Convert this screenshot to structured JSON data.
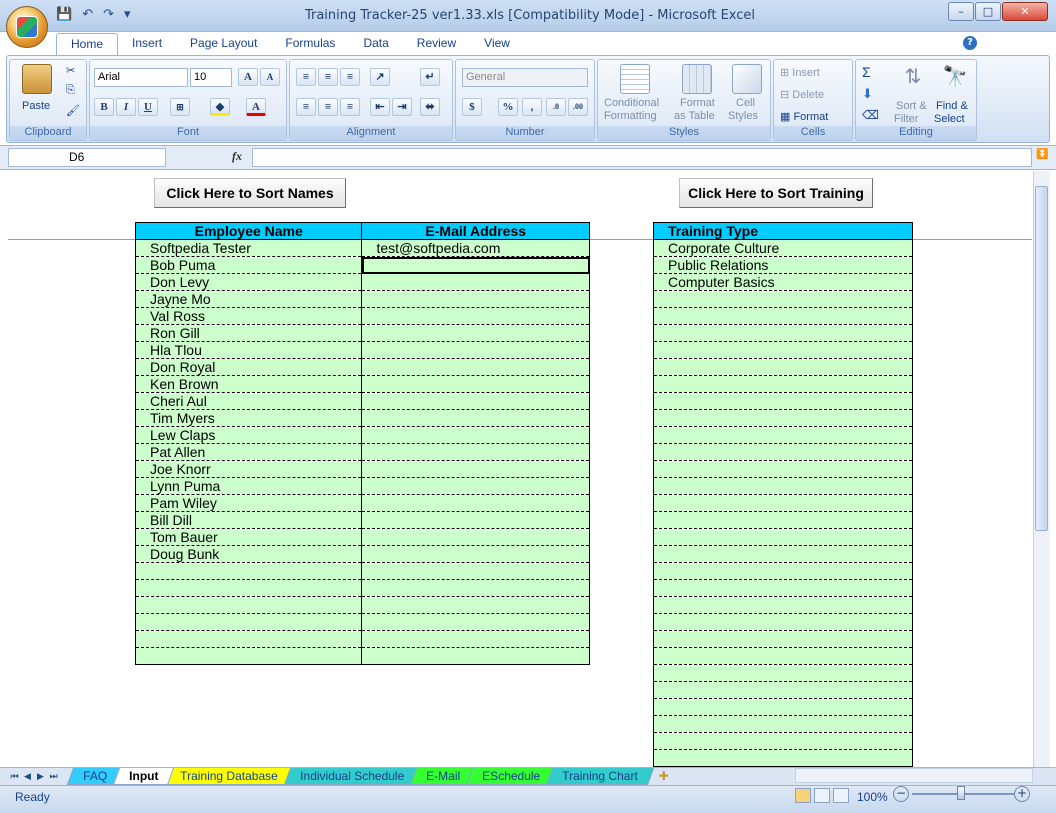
{
  "window": {
    "title": "Training Tracker-25 ver1.33.xls  [Compatibility Mode] - Microsoft Excel",
    "minimize": "–",
    "maximize": "□",
    "close": "✕"
  },
  "ribbon_tabs": [
    "Home",
    "Insert",
    "Page Layout",
    "Formulas",
    "Data",
    "Review",
    "View"
  ],
  "ribbon": {
    "font_name": "Arial",
    "font_size": "10",
    "number_format": "General",
    "paste": "Paste",
    "conditional": "Conditional",
    "formatting": "Formatting",
    "format": "Format",
    "as_table": "as Table",
    "cell": "Cell",
    "styles": "Styles",
    "insert": "Insert",
    "delete": "Delete",
    "format_cells": "Format",
    "sort": "Sort &",
    "filter": "Filter",
    "find": "Find &",
    "select": "Select",
    "groups": {
      "clipboard": "Clipboard",
      "font": "Font",
      "alignment": "Alignment",
      "number": "Number",
      "styles": "Styles",
      "cells": "Cells",
      "editing": "Editing"
    }
  },
  "formula_bar": {
    "name_box": "D6",
    "fx": "fx",
    "value": ""
  },
  "sheet": {
    "sort_names_button": "Click Here to Sort Names",
    "sort_training_button": "Click Here to Sort Training",
    "employee_header": "Employee Name",
    "email_header": "E-Mail Address",
    "training_header": "Training Type",
    "employees": [
      "Softpedia Tester",
      "Bob Puma",
      "Don Levy",
      "Jayne Mo",
      "Val Ross",
      "Ron Gill",
      "Hla Tlou",
      "Don Royal",
      "Ken Brown",
      "Cheri Aul",
      "Tim Myers",
      "Lew Claps",
      "Pat Allen",
      "Joe Knorr",
      "Lynn Puma",
      "Pam Wiley",
      "Bill Dill",
      "Tom Bauer",
      "Doug Bunk"
    ],
    "emails": [
      "test@softpedia.com"
    ],
    "employee_rows": 25,
    "training_types": [
      "Corporate Culture",
      "Public Relations",
      "Computer Basics"
    ],
    "training_rows": 31,
    "selected_row": 2
  },
  "sheet_tabs": [
    {
      "label": "FAQ",
      "color": "#33ccff"
    },
    {
      "label": "Input",
      "color": "#ffffff",
      "active": true
    },
    {
      "label": "Training Database",
      "color": "#ffff00"
    },
    {
      "label": "Individual Schedule",
      "color": "#33cccc"
    },
    {
      "label": "E-Mail",
      "color": "#33ff33"
    },
    {
      "label": "ESchedule",
      "color": "#33ff33"
    },
    {
      "label": "Training Chart",
      "color": "#33cccc"
    }
  ],
  "status": {
    "ready": "Ready",
    "zoom": "100%"
  }
}
